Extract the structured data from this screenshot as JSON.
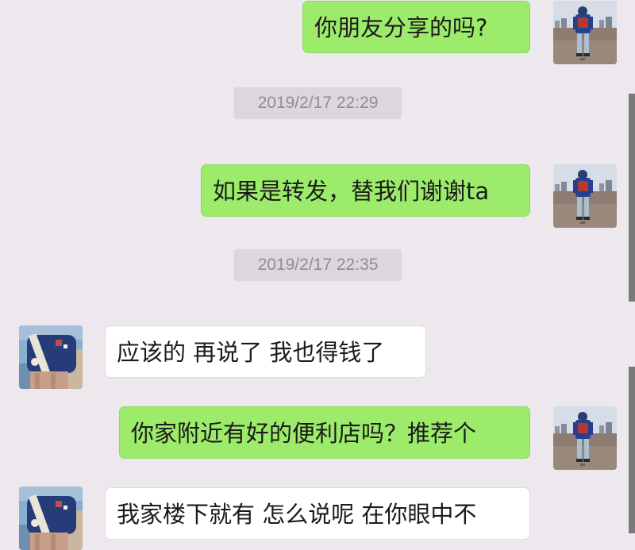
{
  "messages": [
    {
      "type": "sent",
      "text": "你朋友分享的吗?"
    },
    {
      "type": "timestamp",
      "text": "2019/2/17 22:29"
    },
    {
      "type": "sent",
      "text": "如果是转发，替我们谢谢ta"
    },
    {
      "type": "timestamp",
      "text": "2019/2/17 22:35"
    },
    {
      "type": "received",
      "text": "应该的 再说了 我也得钱了"
    },
    {
      "type": "sent",
      "text": "你家附近有好的便利店吗？推荐个"
    },
    {
      "type": "received",
      "text": "我家楼下就有 怎么说呢 在你眼中不"
    }
  ],
  "colors": {
    "background": "#ede8ed",
    "sent_bubble": "#9deb6a",
    "received_bubble": "#ffffff",
    "timestamp_bg": "#dcd7dc"
  },
  "icons": {
    "self_avatar": "person-in-blue-jacket-with-red-backpack-avatar-icon",
    "contact_avatar": "person-in-blue-sweater-avatar-icon"
  }
}
